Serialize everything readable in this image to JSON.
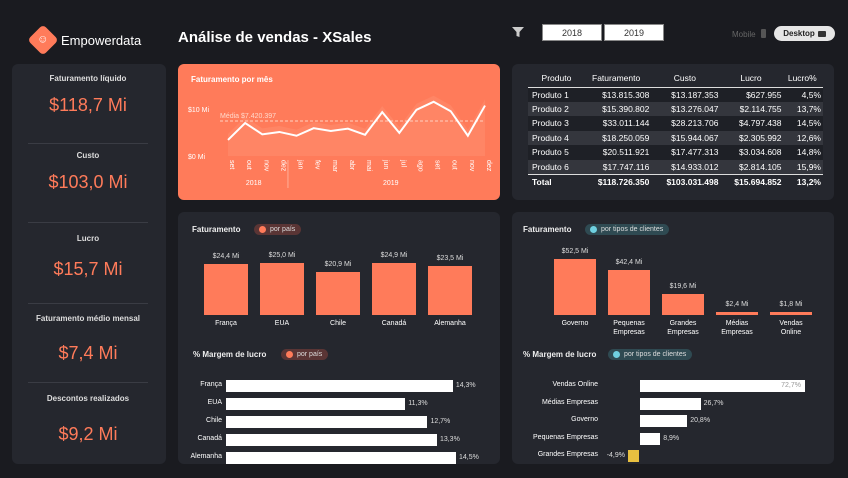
{
  "header": {
    "logo_text": "Empowerdata",
    "title": "Análise de vendas - XSales",
    "years": [
      "2018",
      "2019"
    ],
    "mobile_label": "Mobile",
    "desktop_label": "Desktop"
  },
  "kpis": [
    {
      "label": "Faturamento líquido",
      "value": "$118,7 Mi"
    },
    {
      "label": "Custo",
      "value": "$103,0 Mi"
    },
    {
      "label": "Lucro",
      "value": "$15,7 Mi"
    },
    {
      "label": "Faturamento médio mensal",
      "value": "$7,4 Mi"
    },
    {
      "label": "Descontos realizados",
      "value": "$9,2 Mi"
    }
  ],
  "monthly": {
    "title": "Faturamento por mês",
    "y_ticks": [
      "$10 Mi",
      "$0 Mi"
    ],
    "average_label": "Média $7.420.397",
    "months": [
      "set",
      "out",
      "nov",
      "dez",
      "jan",
      "fev",
      "mar",
      "abr",
      "mai",
      "jun",
      "jul",
      "ago",
      "set",
      "out",
      "nov",
      "dez"
    ],
    "years": [
      "2018",
      "2019"
    ]
  },
  "table": {
    "headers": [
      "Produto",
      "Faturamento",
      "Custo",
      "Lucro",
      "Lucro%"
    ],
    "rows": [
      [
        "Produto 1",
        "$13.815.308",
        "$13.187.353",
        "$627.955",
        "4,5%"
      ],
      [
        "Produto 2",
        "$15.390.802",
        "$13.276.047",
        "$2.114.755",
        "13,7%"
      ],
      [
        "Produto 3",
        "$33.011.144",
        "$28.213.706",
        "$4.797.438",
        "14,5%"
      ],
      [
        "Produto 4",
        "$18.250.059",
        "$15.944.067",
        "$2.305.992",
        "12,6%"
      ],
      [
        "Produto 5",
        "$20.511.921",
        "$17.477.313",
        "$3.034.608",
        "14,8%"
      ],
      [
        "Produto 6",
        "$17.747.116",
        "$14.933.012",
        "$2.814.105",
        "15,9%"
      ]
    ],
    "total": [
      "Total",
      "$118.726.350",
      "$103.031.498",
      "$15.694.852",
      "13,2%"
    ]
  },
  "country_card": {
    "title": "Faturamento",
    "pill": "por país",
    "margin_title": "% Margem de lucro",
    "margin_pill": "por país"
  },
  "client_card": {
    "title": "Faturamento",
    "pill": "por tipos de clientes",
    "margin_title": "% Margem de lucro",
    "margin_pill": "por tipos de clientes"
  },
  "colors": {
    "accent": "#ff7b5a",
    "panel": "#25272e",
    "background": "#1a1b20",
    "negative": "#e8c040"
  },
  "chart_data": [
    {
      "type": "line",
      "title": "Faturamento por mês",
      "x": [
        "set 2018",
        "out 2018",
        "nov 2018",
        "dez 2018",
        "jan 2019",
        "fev 2019",
        "mar 2019",
        "abr 2019",
        "mai 2019",
        "jun 2019",
        "jul 2019",
        "ago 2019",
        "set 2019",
        "out 2019",
        "nov 2019",
        "dez 2019"
      ],
      "values": [
        3.4,
        7.0,
        4.6,
        5.1,
        4.3,
        5.9,
        5.3,
        5.8,
        4.5,
        9.3,
        4.9,
        9.8,
        11.5,
        9.5,
        4.3,
        10.7
      ],
      "average": 7.42,
      "ylim": [
        0,
        14
      ],
      "unit": "$ Mi"
    },
    {
      "type": "bar",
      "title": "Faturamento",
      "categories": [
        "França",
        "EUA",
        "Chile",
        "Canadá",
        "Alemanha"
      ],
      "values": [
        24.4,
        25.0,
        20.9,
        24.9,
        23.5
      ],
      "labels": [
        "$24,4 Mi",
        "$25,0 Mi",
        "$20,9 Mi",
        "$24,9 Mi",
        "$23,5 Mi"
      ]
    },
    {
      "type": "bar",
      "title": "% Margem de lucro",
      "categories": [
        "França",
        "EUA",
        "Chile",
        "Canadá",
        "Alemanha"
      ],
      "values": [
        14.3,
        11.3,
        12.7,
        13.3,
        14.5
      ],
      "labels": [
        "14,3%",
        "11,3%",
        "12,7%",
        "13,3%",
        "14,5%"
      ]
    },
    {
      "type": "bar",
      "title": "Faturamento",
      "categories": [
        "Governo",
        "Pequenas Empresas",
        "Grandes Empresas",
        "Médias Empresas",
        "Vendas Online"
      ],
      "category_lines": [
        [
          "Governo"
        ],
        [
          "Pequenas",
          "Empresas"
        ],
        [
          "Grandes",
          "Empresas"
        ],
        [
          "Médias",
          "Empresas"
        ],
        [
          "Vendas",
          "Online"
        ]
      ],
      "values": [
        52.5,
        42.4,
        19.6,
        2.4,
        1.8
      ],
      "labels": [
        "$52,5 Mi",
        "$42,4 Mi",
        "$19,6 Mi",
        "$2,4 Mi",
        "$1,8 Mi"
      ]
    },
    {
      "type": "bar",
      "title": "% Margem de lucro",
      "categories": [
        "Vendas Online",
        "Médias Empresas",
        "Governo",
        "Pequenas Empresas",
        "Grandes Empresas"
      ],
      "values": [
        72.7,
        26.7,
        20.8,
        8.9,
        -4.9
      ],
      "labels": [
        "72,7%",
        "26,7%",
        "20,8%",
        "8,9%",
        "-4,9%"
      ]
    }
  ]
}
